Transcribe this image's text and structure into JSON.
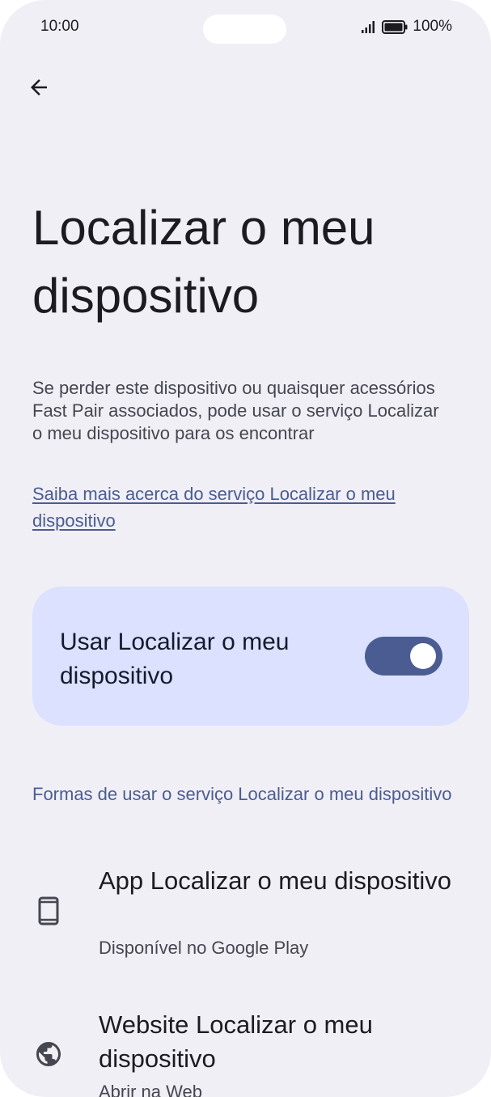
{
  "status_bar": {
    "time": "10:00",
    "battery": "100%"
  },
  "header": {
    "back_icon": "arrow-back-icon"
  },
  "page": {
    "title": "Localizar o meu dispositivo",
    "description": "Se perder este dispositivo ou quaisquer acessórios Fast Pair associados, pode usar o serviço Localizar o meu dispositivo para os encontrar",
    "learn_more": "Saiba mais acerca do serviço Localizar o meu dispositivo"
  },
  "toggle": {
    "label": "Usar Localizar o meu dispositivo",
    "enabled": true
  },
  "section": {
    "header": "Formas de usar o serviço Localizar o meu dispositivo",
    "items": [
      {
        "icon": "phone-icon",
        "title": "App Localizar o meu dispositivo",
        "subtitle": "Disponível no Google Play"
      },
      {
        "icon": "globe-icon",
        "title": "Website Localizar o meu dispositivo",
        "subtitle": "Abrir na Web"
      }
    ]
  },
  "colors": {
    "background": "#f0eff6",
    "accent": "#4a5c92",
    "card": "#dbe1fe"
  }
}
